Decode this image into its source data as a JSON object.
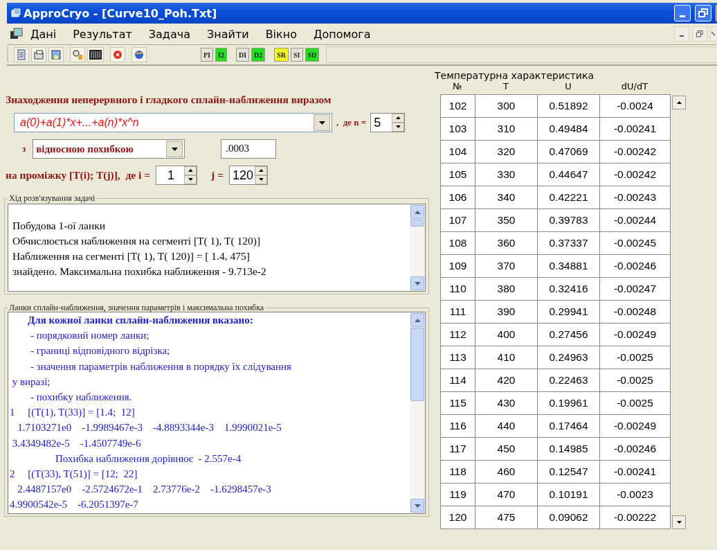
{
  "window": {
    "title": "ApproCryo - [Curve10_Poh.Txt]"
  },
  "menu": [
    {
      "label": "Дані"
    },
    {
      "label": "Результат"
    },
    {
      "label": "Задача"
    },
    {
      "label": "Знайти"
    },
    {
      "label": "Вікно"
    },
    {
      "label": "Допомога"
    }
  ],
  "toolbar_text_buttons": [
    {
      "label": "PI",
      "color": "#e6e4d8"
    },
    {
      "label": "I2",
      "color": "#22dd22"
    },
    {
      "label": "DI",
      "color": "#e6e4d8"
    },
    {
      "label": "D2",
      "color": "#22dd22"
    },
    {
      "label": "SR",
      "color": "#f5f522"
    },
    {
      "label": "SI",
      "color": "#e6e4d8"
    },
    {
      "label": "SD",
      "color": "#22dd22"
    }
  ],
  "setup": {
    "heading": "Знаходження неперервного і гладкого сплайн-наближення виразом",
    "expression": "a(0)+a(1)*x+...+a(n)*x^n",
    "n_label": ",  де n =",
    "n": "5",
    "with_label": "з",
    "error_type": "відносною похибкою",
    "error_value": ".0003",
    "interval_label": "на проміжку [T(i); T(j)],  де i =",
    "i": "1",
    "j_label": "j =",
    "j": "120"
  },
  "progress": {
    "title": "Хід розв'язування задачі",
    "lines": [
      "Побудова 1-ої ланки",
      "Обчислюється наближення на сегменті [T( 1), T( 120)]",
      "Наближення на сегменті [T( 1), T( 120)] = [ 1.4, 475]",
      "знайдено. Максимальна похибка наближення - 9.713e-2"
    ]
  },
  "results": {
    "title": "Ланки сплайн-наближення, значення параметрів і максимальна похибка",
    "lines": [
      {
        "kind": "heading",
        "text": "Для кожної ланки сплайн-наближення вказано:"
      },
      {
        "kind": "item",
        "text": "- порядковий номер ланки;"
      },
      {
        "kind": "item",
        "text": "- границі відповідного відрізка;"
      },
      {
        "kind": "item",
        "text": "- значення параметрів наближення в порядку їх слідування"
      },
      {
        "kind": "plain",
        "text": " у виразі;"
      },
      {
        "kind": "item",
        "text": "- похибку наближення."
      },
      {
        "kind": "plain",
        "text": "1     [(T(1), T(33)] = [1.4;  12]"
      },
      {
        "kind": "plain",
        "text": "   1.7103271e0    -1.9989467e-3    -4.8893344e-3    1.9990021e-5"
      },
      {
        "kind": "plain",
        "text": " 3.4349482e-5    -1.4507749e-6"
      },
      {
        "kind": "error",
        "text": "Похибка наближення дорівнює  - 2.557e-4"
      },
      {
        "kind": "plain",
        "text": "2     [(T(33), T(51)] = [12;  22]"
      },
      {
        "kind": "plain",
        "text": "   2.4487157e0    -2.5724672e-1    2.73776e-2    -1.6298457e-3"
      },
      {
        "kind": "plain",
        "text": "4.9900542e-5    -6.2051397e-7"
      }
    ]
  },
  "table": {
    "title": "Температурна характеристика",
    "columns": [
      "№",
      "T",
      "U",
      "dU/dT"
    ],
    "rows": [
      [
        "102",
        "300",
        "0.51892",
        "-0.0024"
      ],
      [
        "103",
        "310",
        "0.49484",
        "-0.00241"
      ],
      [
        "104",
        "320",
        "0.47069",
        "-0.00242"
      ],
      [
        "105",
        "330",
        "0.44647",
        "-0.00242"
      ],
      [
        "106",
        "340",
        "0.42221",
        "-0.00243"
      ],
      [
        "107",
        "350",
        "0.39783",
        "-0.00244"
      ],
      [
        "108",
        "360",
        "0.37337",
        "-0.00245"
      ],
      [
        "109",
        "370",
        "0.34881",
        "-0.00246"
      ],
      [
        "110",
        "380",
        "0.32416",
        "-0.00247"
      ],
      [
        "111",
        "390",
        "0.29941",
        "-0.00248"
      ],
      [
        "112",
        "400",
        "0.27456",
        "-0.00249"
      ],
      [
        "113",
        "410",
        "0.24963",
        "-0.0025"
      ],
      [
        "114",
        "420",
        "0.22463",
        "-0.0025"
      ],
      [
        "115",
        "430",
        "0.19961",
        "-0.0025"
      ],
      [
        "116",
        "440",
        "0.17464",
        "-0.00249"
      ],
      [
        "117",
        "450",
        "0.14985",
        "-0.00246"
      ],
      [
        "118",
        "460",
        "0.12547",
        "-0.00241"
      ],
      [
        "119",
        "470",
        "0.10191",
        "-0.0023"
      ],
      [
        "120",
        "475",
        "0.09062",
        "-0.00222"
      ]
    ]
  }
}
